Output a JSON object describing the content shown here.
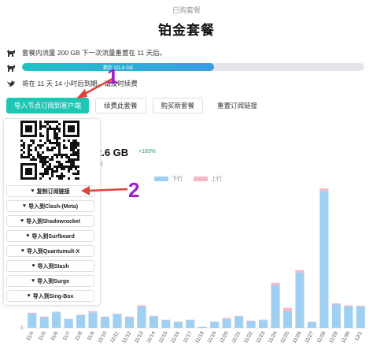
{
  "page": {
    "header": "已购套餐",
    "title": "铂金套餐"
  },
  "info": {
    "traffic_text": "套餐内流量 200 GB   下一次流量重置在 11 天后。",
    "expire_text": "将在 11 天 14 小时后到期，请及时续费"
  },
  "progress": {
    "label": "剩余 111.8 GB",
    "fraction": 0.56
  },
  "buttons": {
    "import": "导入节点订阅到客户端",
    "renew": "续费此套餐",
    "buy_new": "购买新套餐",
    "reset": "重置订阅链接"
  },
  "popover": {
    "items": [
      "复制订阅链接",
      "导入到Clash-(Meta)",
      "导入到Shadowrocket",
      "导入到Surfboard",
      "导入到Quantumult-X",
      "导入到Stash",
      "导入到Surge",
      "导入到Sing-Box"
    ]
  },
  "stats": {
    "total": "2.6 GB",
    "change": "+183%",
    "period": "天"
  },
  "annotations": [
    "1",
    "2"
  ],
  "colors": {
    "download": "#9fd0f2",
    "upload": "#f7b7c4",
    "accent": "#1ec6b4",
    "annotation": "#e0413a"
  },
  "chart_data": {
    "type": "bar",
    "stacked": true,
    "legend": "top",
    "categories": [
      "11/4",
      "11/5",
      "11/6",
      "11/7",
      "11/8",
      "11/9",
      "11/10",
      "11/11",
      "11/12",
      "11/13",
      "11/14",
      "11/15",
      "11/16",
      "11/17",
      "11/18",
      "11/19",
      "11/20",
      "11/21",
      "11/22",
      "11/23",
      "11/24",
      "11/25",
      "11/26",
      "11/27",
      "11/28",
      "11/29",
      "11/30",
      "12/1"
    ],
    "series": [
      {
        "name": "下行",
        "values": [
          0.75,
          0.55,
          0.8,
          0.45,
          0.65,
          0.8,
          0.55,
          0.7,
          0.55,
          1.1,
          0.6,
          0.4,
          0.3,
          0.4,
          0.05,
          0.3,
          0.45,
          0.6,
          0.35,
          0.4,
          2.2,
          0.85,
          2.85,
          0.3,
          7.05,
          1.2,
          1.1,
          1.1
        ]
      },
      {
        "name": "上行",
        "values": [
          0.03,
          0.03,
          0.03,
          0.02,
          0.03,
          0.06,
          0.03,
          0.03,
          0.03,
          0.06,
          0.02,
          0.02,
          0.02,
          0.02,
          0.01,
          0.02,
          0.06,
          0.02,
          0.02,
          0.02,
          0.12,
          0.18,
          0.12,
          0.02,
          0.12,
          0.06,
          0.06,
          0.04
        ]
      }
    ]
  }
}
